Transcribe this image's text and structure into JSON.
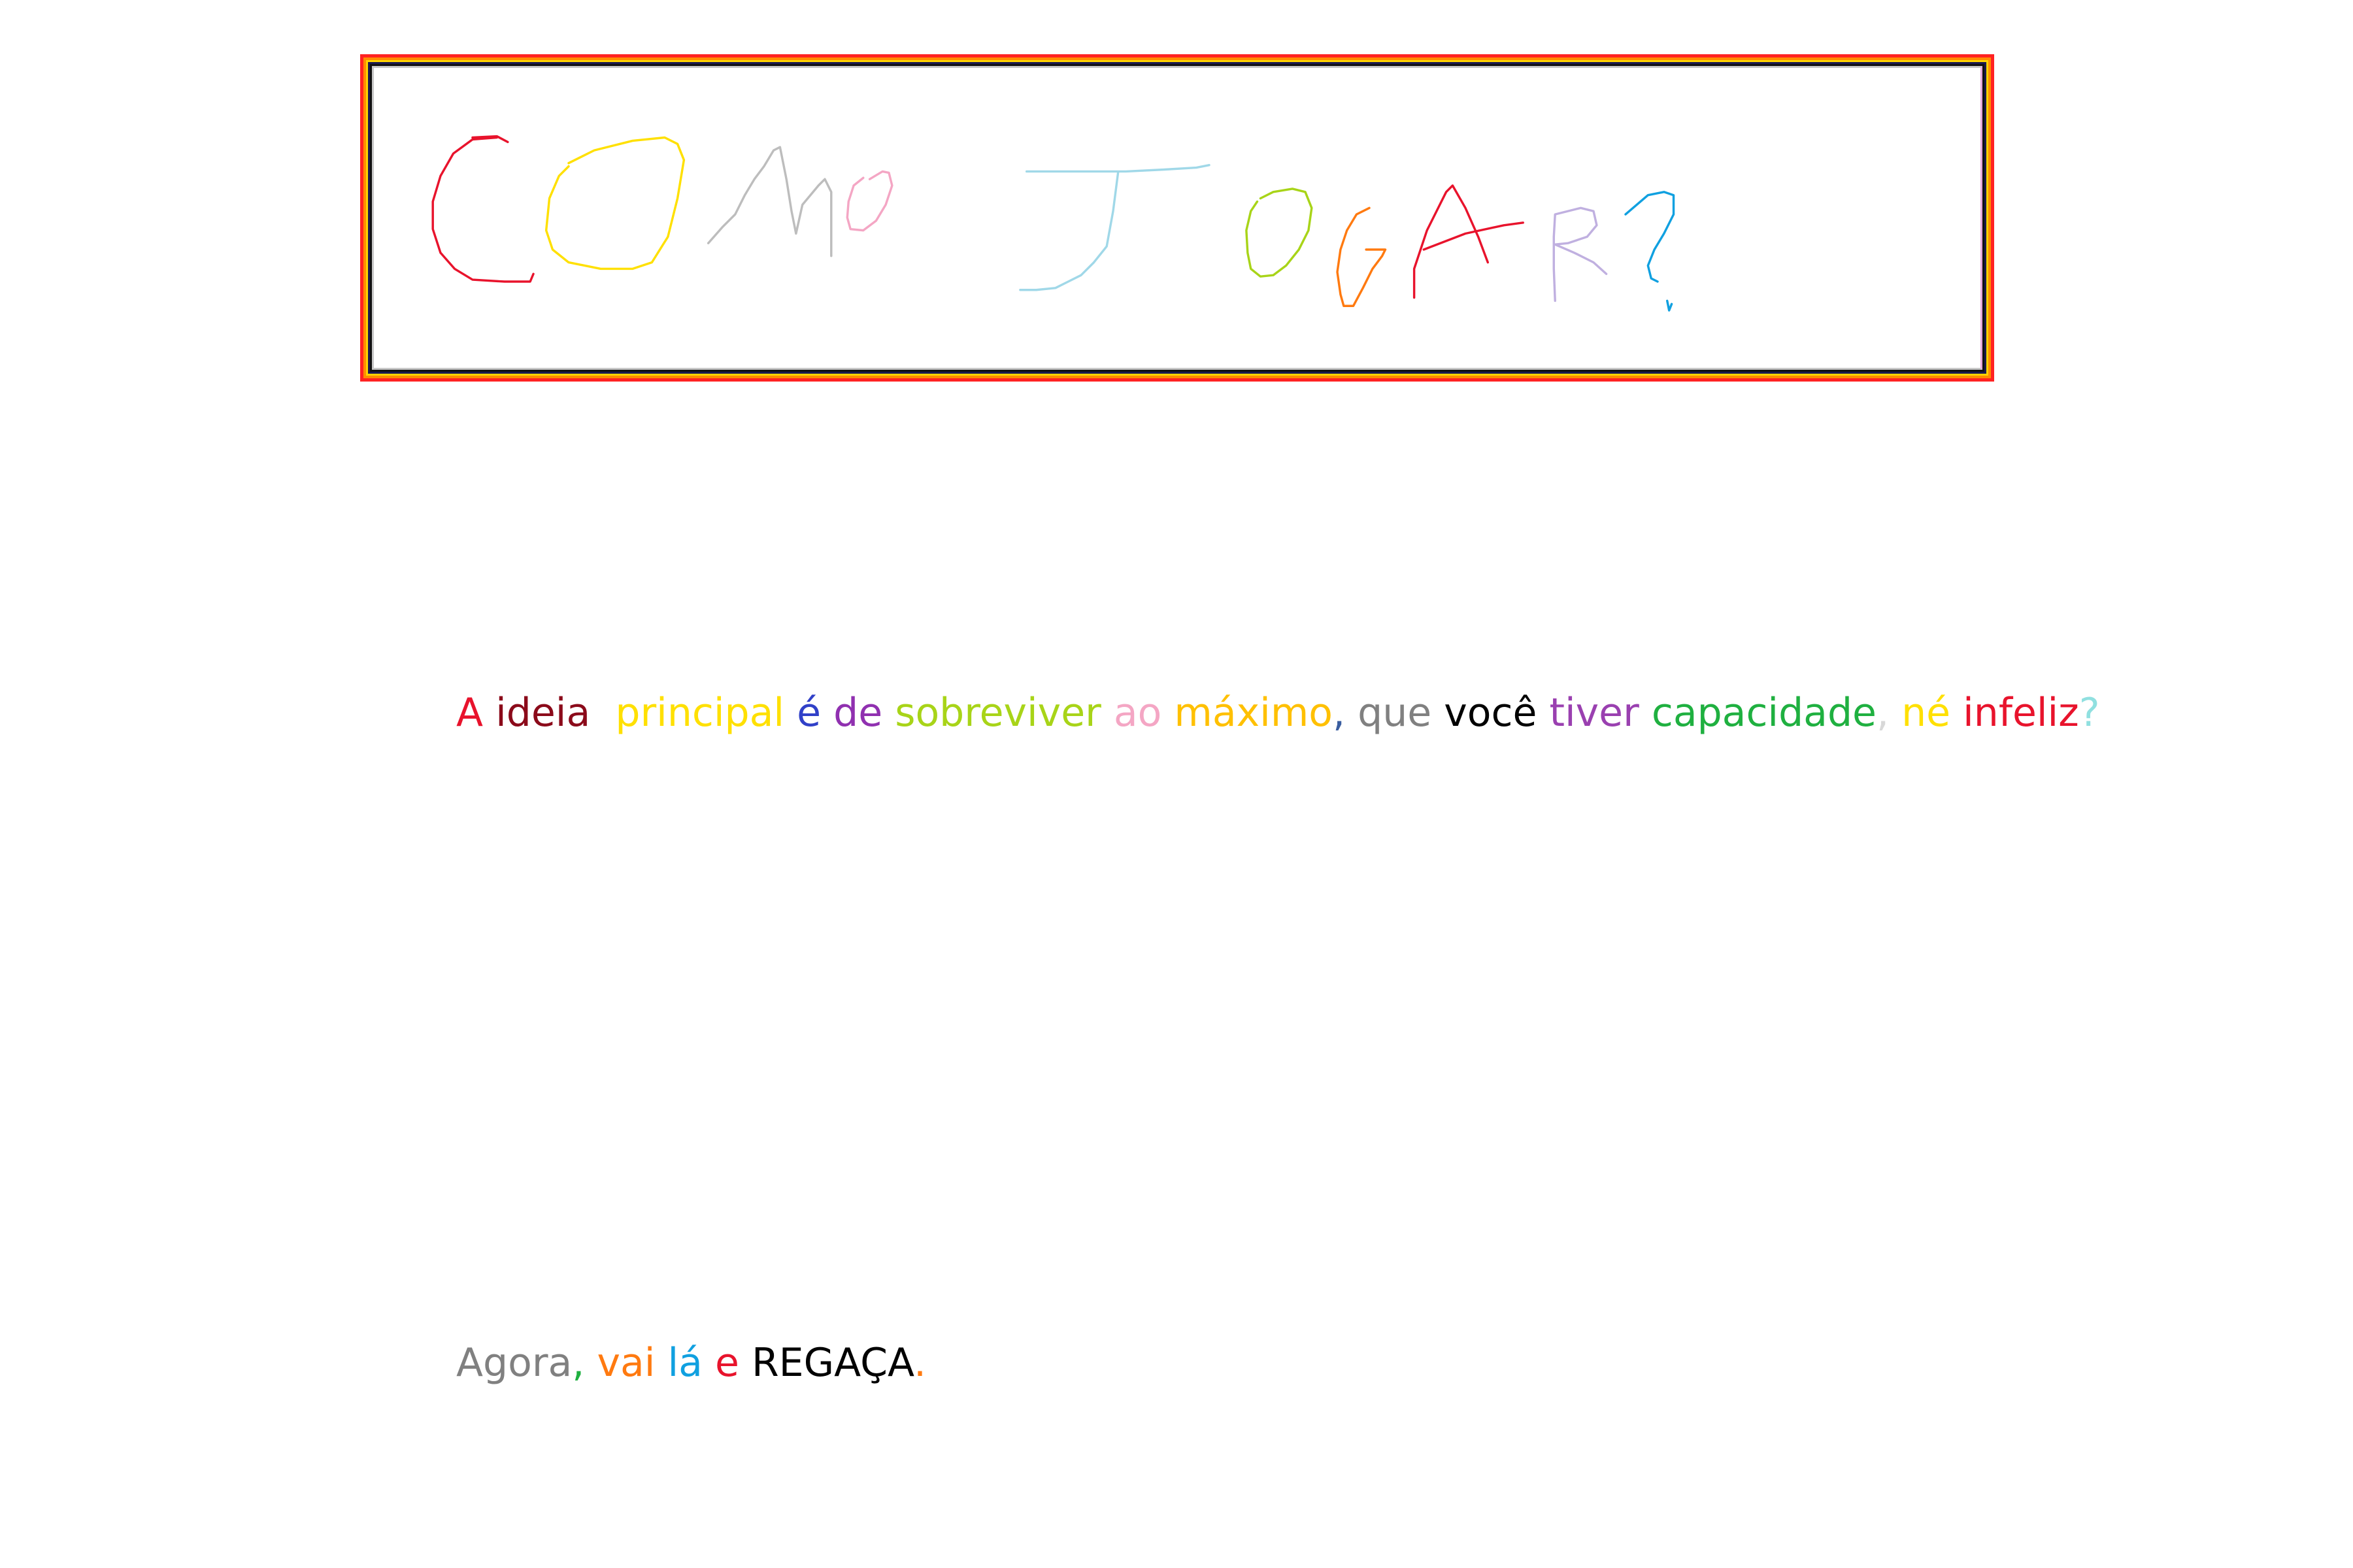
{
  "title": {
    "handwritten_text": "COMO JOGAR?",
    "border_colors": [
      "#ff2222",
      "#ff8c00",
      "#ffd400",
      "#1a1a50",
      "#111111",
      "#c8c8c8"
    ]
  },
  "paragraph1": {
    "words": [
      {
        "text": "A",
        "color": "#e8132c"
      },
      {
        "text": " ",
        "color": "#000000"
      },
      {
        "text": "ideia",
        "color": "#8b0a1a"
      },
      {
        "text": "  ",
        "color": "#000000"
      },
      {
        "text": "principal",
        "color": "#ffe000"
      },
      {
        "text": " ",
        "color": "#000000"
      },
      {
        "text": "é",
        "color": "#3040c8"
      },
      {
        "text": " ",
        "color": "#000000"
      },
      {
        "text": "de",
        "color": "#9030b0"
      },
      {
        "text": " ",
        "color": "#000000"
      },
      {
        "text": "sobreviver",
        "color": "#a8d418"
      },
      {
        "text": " ",
        "color": "#000000"
      },
      {
        "text": "ao",
        "color": "#f4a6c4"
      },
      {
        "text": " ",
        "color": "#000000"
      },
      {
        "text": "máximo",
        "color": "#ffc000"
      },
      {
        "text": ",",
        "color": "#3a5ea0"
      },
      {
        "text": " ",
        "color": "#000000"
      },
      {
        "text": "que",
        "color": "#808080"
      },
      {
        "text": " ",
        "color": "#000000"
      },
      {
        "text": "você",
        "color": "#000000"
      },
      {
        "text": " ",
        "color": "#000000"
      },
      {
        "text": "tiver",
        "color": "#9a40b0"
      },
      {
        "text": " ",
        "color": "#000000"
      },
      {
        "text": "capacidade",
        "color": "#1fb040"
      },
      {
        "text": ",",
        "color": "#d8d8d8"
      },
      {
        "text": " ",
        "color": "#000000"
      },
      {
        "text": "né",
        "color": "#ffe000"
      },
      {
        "text": " ",
        "color": "#000000"
      },
      {
        "text": "infeliz",
        "color": "#e8132c"
      },
      {
        "text": "?",
        "color": "#90e0e0"
      }
    ]
  },
  "paragraph2": {
    "words": [
      {
        "text": "Agora",
        "color": "#808080"
      },
      {
        "text": ",",
        "color": "#1fb040"
      },
      {
        "text": " ",
        "color": "#000000"
      },
      {
        "text": "vai",
        "color": "#ff7a10"
      },
      {
        "text": " ",
        "color": "#000000"
      },
      {
        "text": "lá",
        "color": "#10a0e0"
      },
      {
        "text": " ",
        "color": "#000000"
      },
      {
        "text": "e",
        "color": "#e8132c"
      },
      {
        "text": " ",
        "color": "#000000"
      },
      {
        "text": "REGAÇA",
        "color": "#000000"
      },
      {
        "text": ".",
        "color": "#ff7a10"
      }
    ]
  }
}
